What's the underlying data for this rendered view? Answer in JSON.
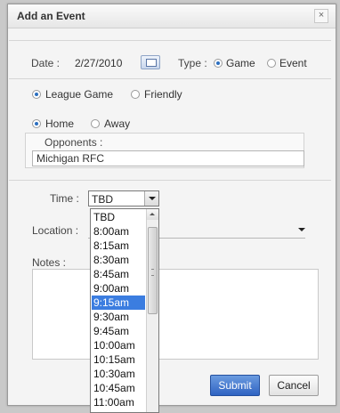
{
  "dialog": {
    "title": "Add an Event",
    "close_glyph": "×"
  },
  "date": {
    "label": "Date :",
    "value": "2/27/2010"
  },
  "type": {
    "label": "Type :",
    "options": [
      "Game",
      "Event"
    ],
    "selected": "Game"
  },
  "game_kind": {
    "options": [
      "League Game",
      "Friendly"
    ],
    "selected": "League Game"
  },
  "venue": {
    "options": [
      "Home",
      "Away"
    ],
    "selected": "Home"
  },
  "opponents": {
    "label": "Opponents :",
    "value": "Michigan RFC"
  },
  "time": {
    "label": "Time :",
    "value": "TBD",
    "selected_highlight": "9:15am",
    "options": [
      "TBD",
      "8:00am",
      "8:15am",
      "8:30am",
      "8:45am",
      "9:00am",
      "9:15am",
      "9:30am",
      "9:45am",
      "10:00am",
      "10:15am",
      "10:30am",
      "10:45am",
      "11:00am"
    ]
  },
  "location": {
    "label": "Location :",
    "value": ""
  },
  "notes": {
    "label": "Notes :",
    "value": ""
  },
  "buttons": {
    "submit": "Submit",
    "cancel": "Cancel"
  },
  "colors": {
    "accent": "#2f63c2",
    "highlight": "#3b7de0"
  },
  "icons": {
    "calendar": "calendar-icon",
    "close": "close-icon"
  }
}
